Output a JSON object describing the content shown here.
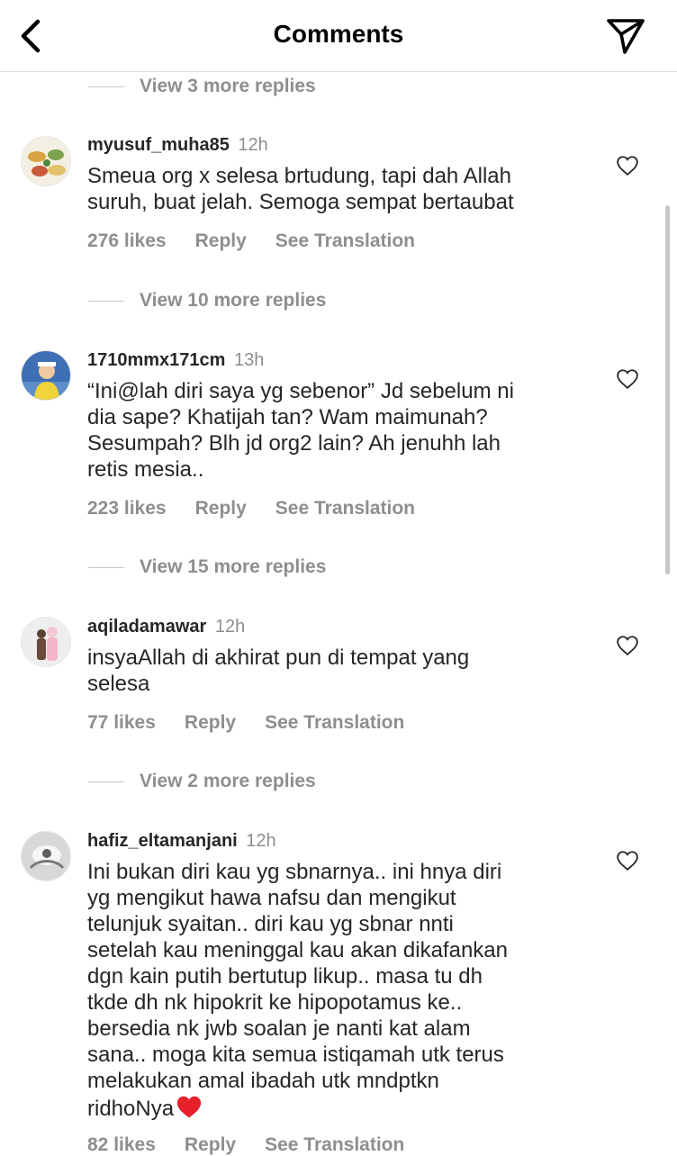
{
  "header": {
    "title": "Comments"
  },
  "view_replies": [
    {
      "label": "View 3 more replies"
    },
    {
      "label": "View 10 more replies"
    },
    {
      "label": "View 15 more replies"
    },
    {
      "label": "View 2 more replies"
    }
  ],
  "comments": [
    {
      "username": "myusuf_muha85",
      "time": "12h",
      "text": "Smeua org x selesa brtudung, tapi dah Allah\nsuruh, buat jelah. Semoga sempat bertaubat",
      "likes": "276 likes",
      "reply": "Reply",
      "translation": "See Translation"
    },
    {
      "username": "1710mmx171cm",
      "time": "13h",
      "text": "“Ini@lah diri saya yg sebenor” Jd sebelum ni\ndia sape? Khatijah tan? Wam maimunah?\nSesumpah? Blh jd org2 lain? Ah jenuhh lah\nretis mesia..",
      "likes": "223 likes",
      "reply": "Reply",
      "translation": "See Translation"
    },
    {
      "username": "aqiladamawar",
      "time": "12h",
      "text": "insyaAllah di akhirat pun di tempat yang\nselesa",
      "likes": "77 likes",
      "reply": "Reply",
      "translation": "See Translation"
    },
    {
      "username": "hafiz_eltamanjani",
      "time": "12h",
      "text": "Ini bukan diri kau yg sbnarnya.. ini hnya diri\nyg mengikut hawa nafsu dan mengikut\ntelunjuk syaitan.. diri kau yg sbnar nnti\nsetelah kau meninggal kau akan dikafankan\ndgn kain putih bertutup likup.. masa tu dh\ntkde dh nk hipokrit ke hipopotamus ke..\nbersedia nk jwb soalan je nanti kat alam\nsana.. moga kita semua istiqamah utk terus\nmelakukan amal ibadah utk mndptkn\nridhoNya",
      "likes": "82 likes",
      "reply": "Reply",
      "translation": "See Translation"
    }
  ],
  "icons": {
    "back": "chevron-left-icon",
    "send": "paper-plane-icon",
    "like": "heart-outline-icon",
    "emoji": "red-heart-emoji"
  },
  "colors": {
    "text": "#262626",
    "secondary": "#8e8e8e",
    "divider": "#dbdbdb",
    "heart": "#e8202c"
  }
}
